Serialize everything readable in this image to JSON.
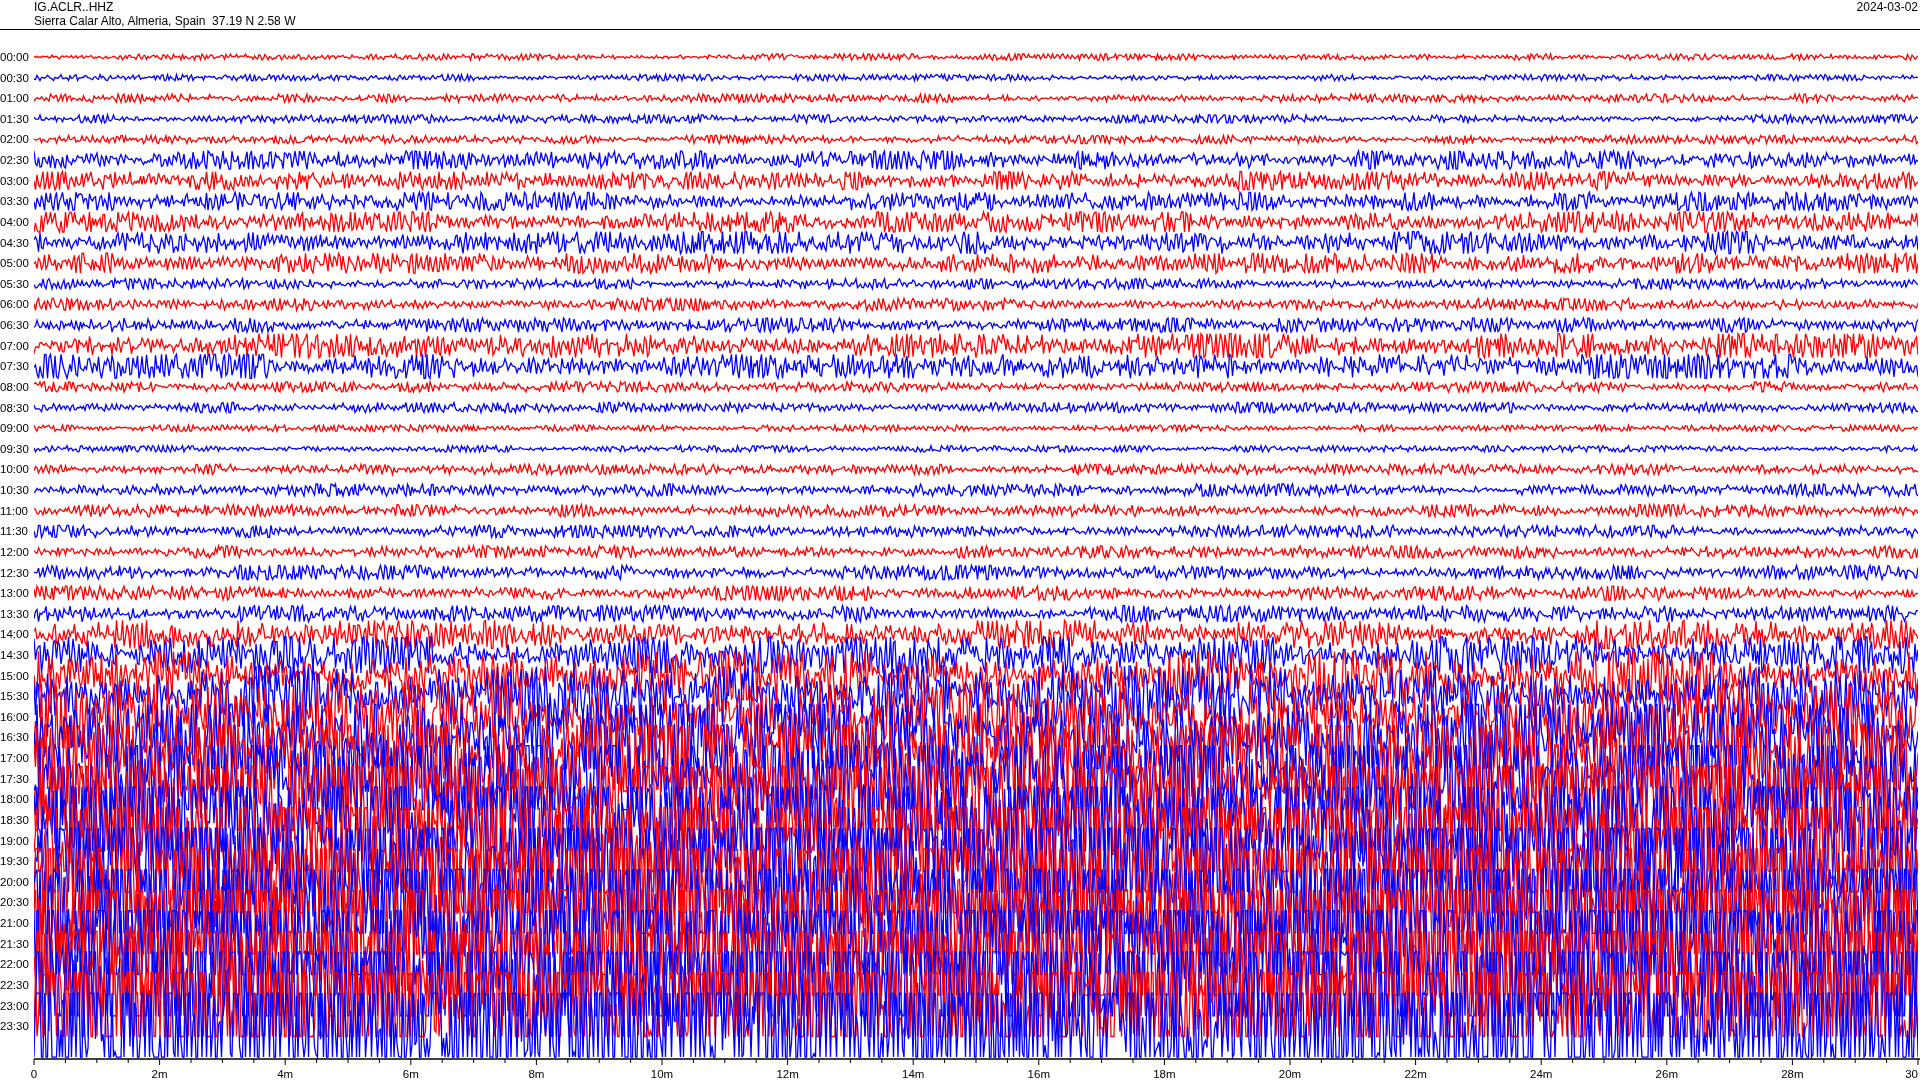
{
  "header": {
    "station": "IG.ACLR..HHZ",
    "location": "Sierra Calar Alto, Almeria, Spain  37.19 N 2.58 W",
    "date": "2024-03-02"
  },
  "traces": [
    {
      "label": "00:00",
      "color": "#ff0000"
    },
    {
      "label": "00:30",
      "color": "#0000ff"
    },
    {
      "label": "01:00",
      "color": "#ff0000"
    },
    {
      "label": "01:30",
      "color": "#0000ff"
    },
    {
      "label": "02:00",
      "color": "#ff0000"
    },
    {
      "label": "02:30",
      "color": "#0000ff"
    },
    {
      "label": "03:00",
      "color": "#ff0000"
    },
    {
      "label": "03:30",
      "color": "#0000ff"
    },
    {
      "label": "04:00",
      "color": "#ff0000"
    },
    {
      "label": "04:30",
      "color": "#0000ff"
    },
    {
      "label": "05:00",
      "color": "#ff0000"
    },
    {
      "label": "05:30",
      "color": "#0000ff"
    },
    {
      "label": "06:00",
      "color": "#ff0000"
    },
    {
      "label": "06:30",
      "color": "#0000ff"
    },
    {
      "label": "07:00",
      "color": "#ff0000"
    },
    {
      "label": "07:30",
      "color": "#0000ff"
    },
    {
      "label": "08:00",
      "color": "#ff0000"
    },
    {
      "label": "08:30",
      "color": "#0000ff"
    },
    {
      "label": "09:00",
      "color": "#ff0000"
    },
    {
      "label": "09:30",
      "color": "#0000ff"
    },
    {
      "label": "10:00",
      "color": "#ff0000"
    },
    {
      "label": "10:30",
      "color": "#0000ff"
    },
    {
      "label": "11:00",
      "color": "#ff0000"
    },
    {
      "label": "11:30",
      "color": "#0000ff"
    },
    {
      "label": "12:00",
      "color": "#ff0000"
    },
    {
      "label": "12:30",
      "color": "#0000ff"
    },
    {
      "label": "13:00",
      "color": "#ff0000"
    },
    {
      "label": "13:30",
      "color": "#0000ff"
    },
    {
      "label": "14:00",
      "color": "#ff0000"
    },
    {
      "label": "14:30",
      "color": "#0000ff"
    },
    {
      "label": "15:00",
      "color": "#ff0000"
    },
    {
      "label": "15:30",
      "color": "#0000ff"
    },
    {
      "label": "16:00",
      "color": "#ff0000"
    },
    {
      "label": "16:30",
      "color": "#0000ff"
    },
    {
      "label": "17:00",
      "color": "#ff0000"
    },
    {
      "label": "17:30",
      "color": "#0000ff"
    },
    {
      "label": "18:00",
      "color": "#ff0000"
    },
    {
      "label": "18:30",
      "color": "#0000ff"
    },
    {
      "label": "19:00",
      "color": "#ff0000"
    },
    {
      "label": "19:30",
      "color": "#0000ff"
    },
    {
      "label": "20:00",
      "color": "#ff0000"
    },
    {
      "label": "20:30",
      "color": "#0000ff"
    },
    {
      "label": "21:00",
      "color": "#ff0000"
    },
    {
      "label": "21:30",
      "color": "#0000ff"
    },
    {
      "label": "22:00",
      "color": "#ff0000"
    },
    {
      "label": "22:30",
      "color": "#0000ff"
    },
    {
      "label": "23:00",
      "color": "#ff0000"
    },
    {
      "label": "23:30",
      "color": "#0000ff"
    }
  ],
  "x_axis": {
    "tick_labels": [
      "0",
      "2m",
      "4m",
      "6m",
      "8m",
      "10m",
      "12m",
      "14m",
      "16m",
      "18m",
      "20m",
      "22m",
      "24m",
      "26m",
      "28m",
      "30"
    ]
  }
}
